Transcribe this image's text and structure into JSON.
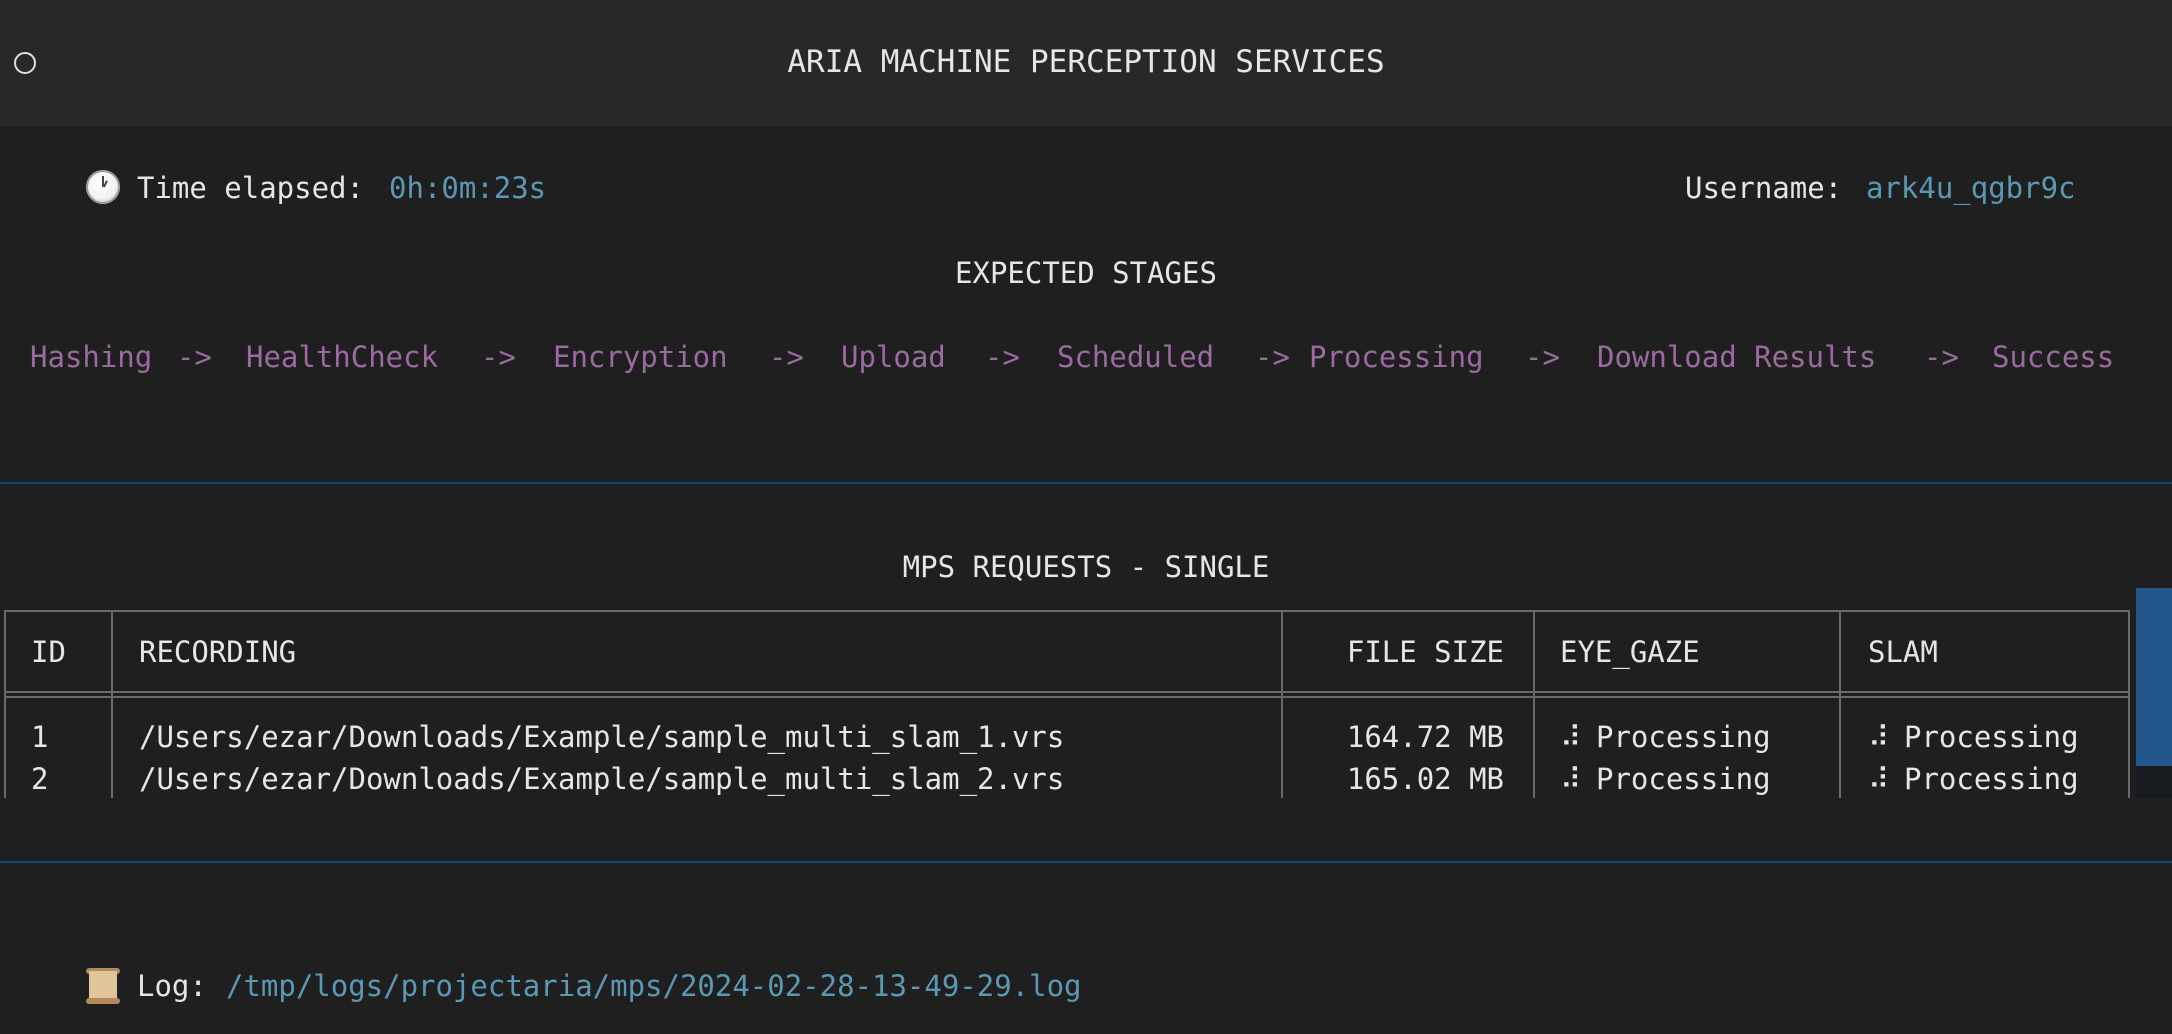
{
  "titlebar": {
    "title": "ARIA MACHINE PERCEPTION SERVICES",
    "window_icon": "circle-icon"
  },
  "status": {
    "time_label": "Time elapsed: ",
    "time_value": "0h:0m:23s",
    "time_icon": "clock-icon",
    "username_label": "Username: ",
    "username_value": "ark4u_qgbr9c"
  },
  "stages": {
    "heading": "EXPECTED STAGES",
    "items": [
      "Hashing",
      "HealthCheck",
      "Encryption",
      "Upload",
      "Scheduled",
      "Processing",
      "Download Results",
      "Success"
    ],
    "arrow": "->"
  },
  "requests": {
    "heading": "MPS REQUESTS - SINGLE",
    "columns": [
      "ID",
      "RECORDING",
      "FILE SIZE",
      "EYE_GAZE",
      "SLAM"
    ],
    "rows": [
      {
        "id": "1",
        "recording": "/Users/ezar/Downloads/Example/sample_multi_slam_1.vrs",
        "file_size": "164.72 MB",
        "eye_gaze": "Processing",
        "slam": "Processing"
      },
      {
        "id": "2",
        "recording": "/Users/ezar/Downloads/Example/sample_multi_slam_2.vrs",
        "file_size": "165.02 MB",
        "eye_gaze": "Processing",
        "slam": "Processing"
      }
    ],
    "spinner_glyph": "⠼"
  },
  "log": {
    "label": "Log: ",
    "path": "/tmp/logs/projectaria/mps/2024-02-28-13-49-29.log",
    "icon": "scroll-icon"
  },
  "colors": {
    "accent": "#5b98b4",
    "stage": "#9a6aa0",
    "separator": "#0b4a7a",
    "scrollbar_thumb": "#23568b"
  }
}
